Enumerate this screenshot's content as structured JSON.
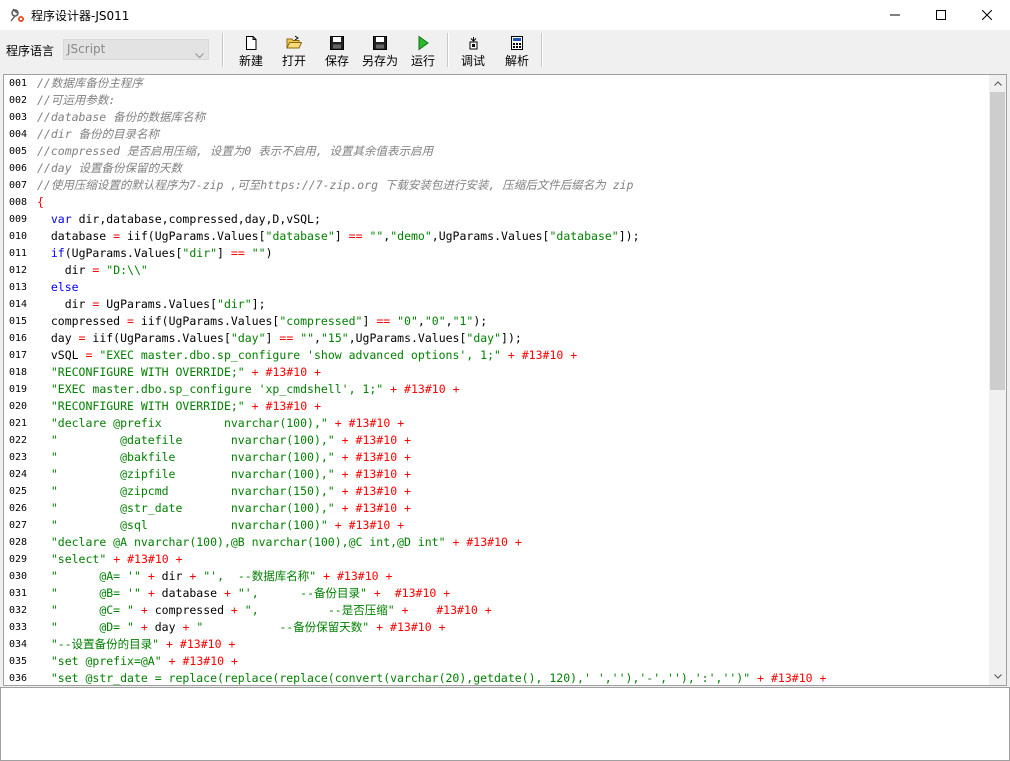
{
  "window": {
    "title": "程序设计器-JS011",
    "icon": "app-gear-icon"
  },
  "toolbar": {
    "lang_label": "程序语言",
    "lang_value": "JScript",
    "buttons": [
      {
        "label": "新建",
        "icon": "new-file-icon"
      },
      {
        "label": "打开",
        "icon": "open-folder-icon"
      },
      {
        "label": "保存",
        "icon": "save-icon"
      },
      {
        "label": "另存为",
        "icon": "save-as-icon"
      },
      {
        "label": "运行",
        "icon": "run-icon"
      },
      {
        "label": "调试",
        "icon": "debug-icon"
      },
      {
        "label": "解析",
        "icon": "parse-icon"
      }
    ]
  },
  "editor": {
    "lines": [
      {
        "n": "001",
        "t": "//数据库备份主程序"
      },
      {
        "n": "002",
        "t": "//可运用参数:"
      },
      {
        "n": "003",
        "t": "//database 备份的数据库名称"
      },
      {
        "n": "004",
        "t": "//dir 备份的目录名称"
      },
      {
        "n": "005",
        "t": "//compressed 是否启用压缩, 设置为0 表示不启用, 设置其余值表示启用"
      },
      {
        "n": "006",
        "t": "//day 设置备份保留的天数"
      },
      {
        "n": "007",
        "t": "//使用压缩设置的默认程序为7-zip ,可至https://7-zip.org 下载安装包进行安装, 压缩后文件后缀名为 zip"
      },
      {
        "n": "008",
        "t": "{"
      },
      {
        "n": "009",
        "t": "  var dir,database,compressed,day,D,vSQL;"
      },
      {
        "n": "010",
        "t": "  database = iif(UgParams.Values[\"database\"] == \"\",\"demo\",UgParams.Values[\"database\"]);"
      },
      {
        "n": "011",
        "t": "  if(UgParams.Values[\"dir\"] == \"\")"
      },
      {
        "n": "012",
        "t": "    dir = \"D:\\\\\""
      },
      {
        "n": "013",
        "t": "  else"
      },
      {
        "n": "014",
        "t": "    dir = UgParams.Values[\"dir\"];"
      },
      {
        "n": "015",
        "t": "  compressed = iif(UgParams.Values[\"compressed\"] == \"0\",\"0\",\"1\");"
      },
      {
        "n": "016",
        "t": "  day = iif(UgParams.Values[\"day\"] == \"\",\"15\",UgParams.Values[\"day\"]);"
      },
      {
        "n": "017",
        "t": "  vSQL = \"EXEC master.dbo.sp_configure 'show advanced options', 1;\" + #13#10 +"
      },
      {
        "n": "018",
        "t": "  \"RECONFIGURE WITH OVERRIDE;\" + #13#10 +"
      },
      {
        "n": "019",
        "t": "  \"EXEC master.dbo.sp_configure 'xp_cmdshell', 1;\" + #13#10 +"
      },
      {
        "n": "020",
        "t": "  \"RECONFIGURE WITH OVERRIDE;\" + #13#10 +"
      },
      {
        "n": "021",
        "t": "  \"declare @prefix         nvarchar(100),\" + #13#10 +"
      },
      {
        "n": "022",
        "t": "  \"         @datefile       nvarchar(100),\" + #13#10 +"
      },
      {
        "n": "023",
        "t": "  \"         @bakfile        nvarchar(100),\" + #13#10 +"
      },
      {
        "n": "024",
        "t": "  \"         @zipfile        nvarchar(100),\" + #13#10 +"
      },
      {
        "n": "025",
        "t": "  \"         @zipcmd         nvarchar(150),\" + #13#10 +"
      },
      {
        "n": "026",
        "t": "  \"         @str_date       nvarchar(100),\" + #13#10 +"
      },
      {
        "n": "027",
        "t": "  \"         @sql            nvarchar(100)\" + #13#10 +"
      },
      {
        "n": "028",
        "t": "  \"declare @A nvarchar(100),@B nvarchar(100),@C int,@D int\" + #13#10 +"
      },
      {
        "n": "029",
        "t": "  \"select\" + #13#10 +"
      },
      {
        "n": "030",
        "t": "  \"      @A= '\" + dir + \"',  --数据库名称\" + #13#10 +"
      },
      {
        "n": "031",
        "t": "  \"      @B= '\" + database + \"',      --备份目录\" +  #13#10 +"
      },
      {
        "n": "032",
        "t": "  \"      @C= \" + compressed + \",          --是否压缩\" +    #13#10 +"
      },
      {
        "n": "033",
        "t": "  \"      @D= \" + day + \"           --备份保留天数\" + #13#10 +"
      },
      {
        "n": "034",
        "t": "  \"--设置备份的目录\" + #13#10 +"
      },
      {
        "n": "035",
        "t": "  \"set @prefix=@A\" + #13#10 +"
      },
      {
        "n": "036",
        "t": "  \"set @str_date = replace(replace(replace(convert(varchar(20),getdate(), 120),' ',''),'-',''),':','')\" + #13#10 +"
      }
    ]
  },
  "colors": {
    "comment": "#808080",
    "string": "#008000",
    "keyword": "#0000ff",
    "operator": "#ff0000"
  }
}
